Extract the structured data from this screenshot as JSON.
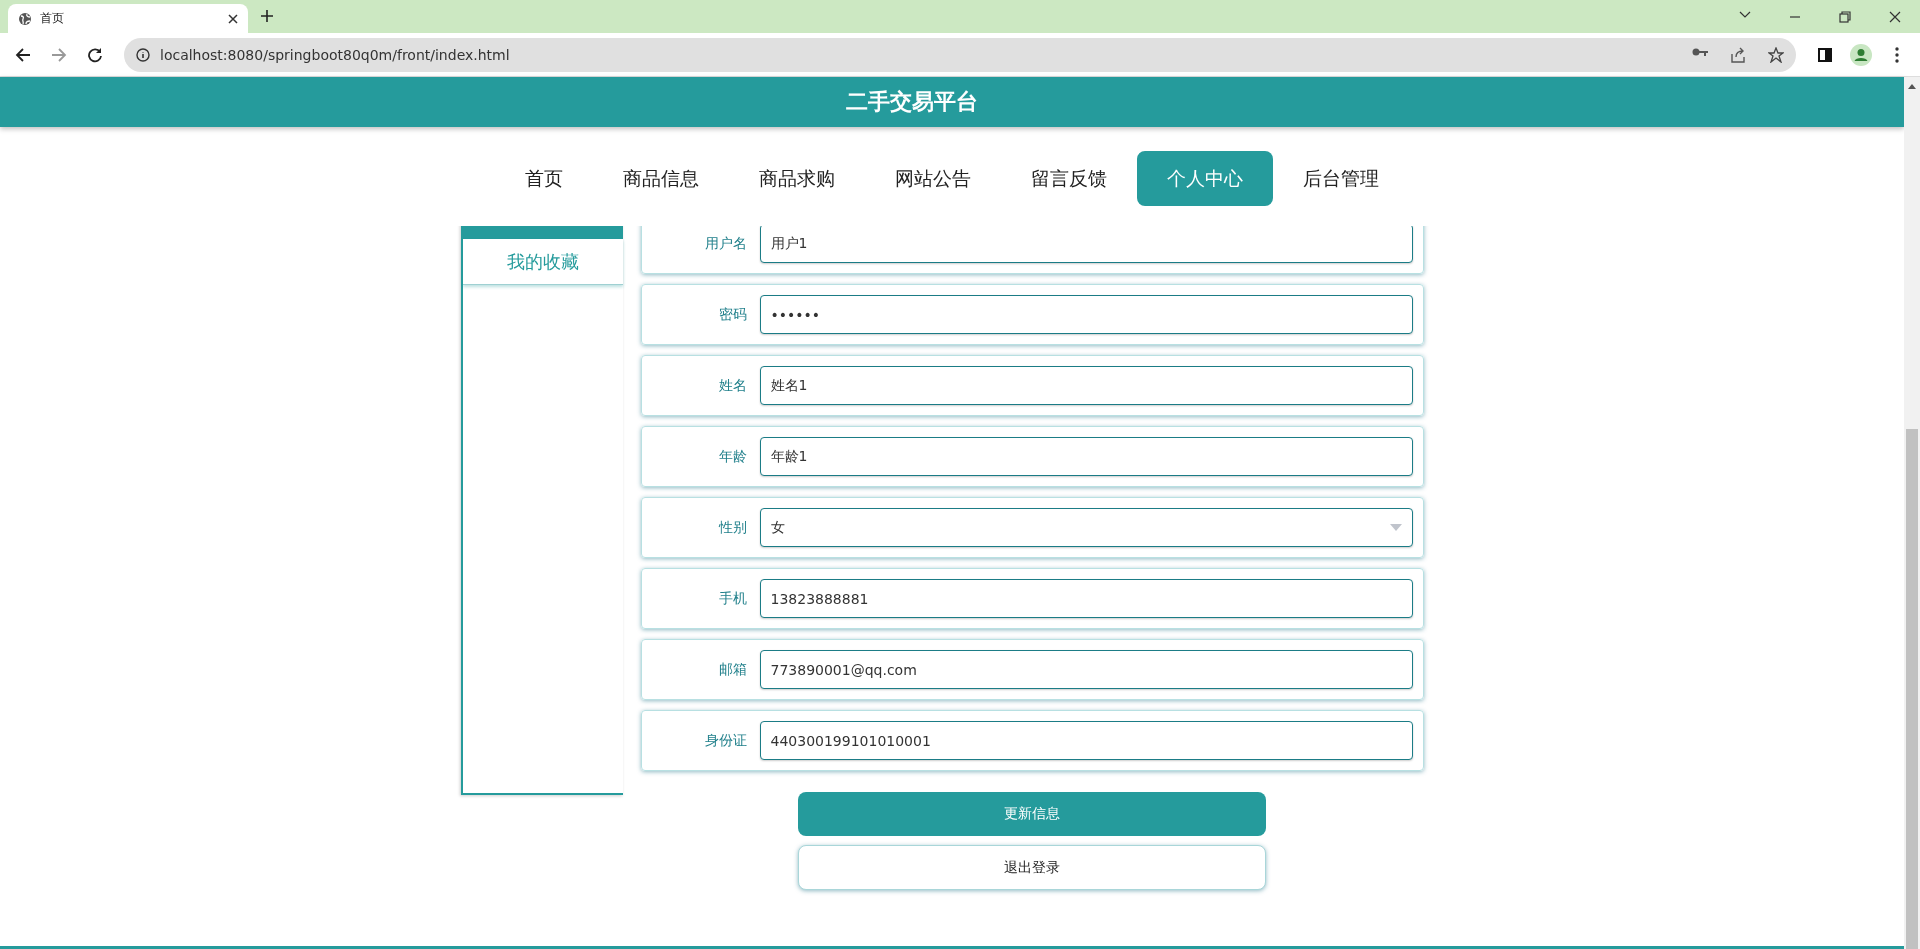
{
  "browser": {
    "tab_title": "首页",
    "url": "localhost:8080/springboot80q0m/front/index.html"
  },
  "header": {
    "title": "二手交易平台"
  },
  "nav": [
    {
      "label": "首页",
      "selected": false
    },
    {
      "label": "商品信息",
      "selected": false
    },
    {
      "label": "商品求购",
      "selected": false
    },
    {
      "label": "网站公告",
      "selected": false
    },
    {
      "label": "留言反馈",
      "selected": false
    },
    {
      "label": "个人中心",
      "selected": true
    },
    {
      "label": "后台管理",
      "selected": false
    }
  ],
  "sidebar": {
    "items": [
      {
        "label": "我的收藏"
      }
    ]
  },
  "form": {
    "fields": [
      {
        "label": "用户名",
        "kind": "text",
        "value": "用户1"
      },
      {
        "label": "密码",
        "kind": "text",
        "value": "••••••"
      },
      {
        "label": "姓名",
        "kind": "text",
        "value": "姓名1"
      },
      {
        "label": "年龄",
        "kind": "text",
        "value": "年龄1"
      },
      {
        "label": "性别",
        "kind": "select",
        "value": "女"
      },
      {
        "label": "手机",
        "kind": "text",
        "value": "13823888881"
      },
      {
        "label": "邮箱",
        "kind": "text",
        "value": "773890001@qq.com"
      },
      {
        "label": "身份证",
        "kind": "text",
        "value": "440300199101010001"
      }
    ]
  },
  "buttons": [
    {
      "label": "更新信息",
      "kind": "primary"
    },
    {
      "label": "退出登录",
      "kind": "secondary"
    }
  ]
}
